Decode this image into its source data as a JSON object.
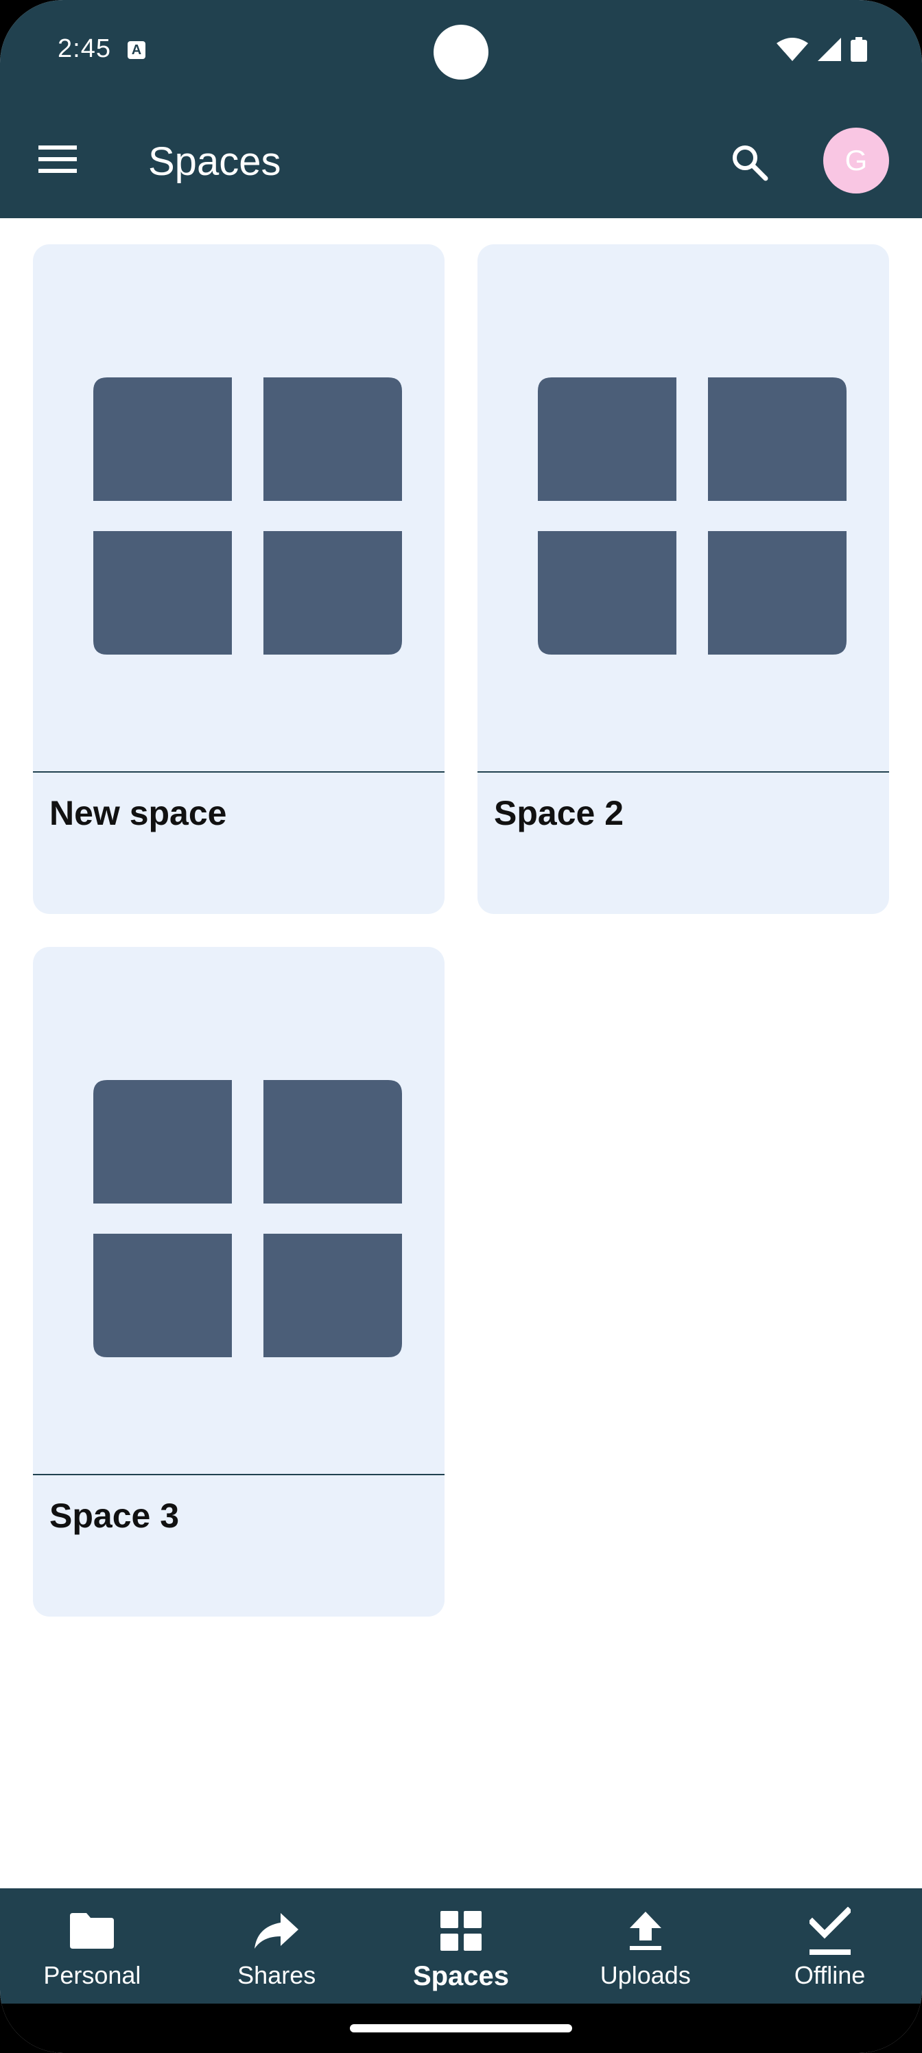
{
  "status_bar": {
    "time": "2:45",
    "notification_icon_letter": "A",
    "icons": [
      "wifi-icon",
      "signal-icon",
      "battery-icon"
    ]
  },
  "app_bar": {
    "title": "Spaces",
    "avatar_initial": "G",
    "avatar_color": "#f9c6e3",
    "bar_color": "#21414f"
  },
  "spaces": [
    {
      "name": "New space"
    },
    {
      "name": "Space 2"
    },
    {
      "name": "Space 3"
    }
  ],
  "card_color": "#eaf1fb",
  "thumb_icon_color": "#4b5e78",
  "bottom_nav": {
    "active": "Spaces",
    "items": [
      {
        "label": "Personal",
        "icon": "folder-icon"
      },
      {
        "label": "Shares",
        "icon": "share-icon"
      },
      {
        "label": "Spaces",
        "icon": "grid-icon"
      },
      {
        "label": "Uploads",
        "icon": "upload-icon"
      },
      {
        "label": "Offline",
        "icon": "check-icon"
      }
    ]
  }
}
